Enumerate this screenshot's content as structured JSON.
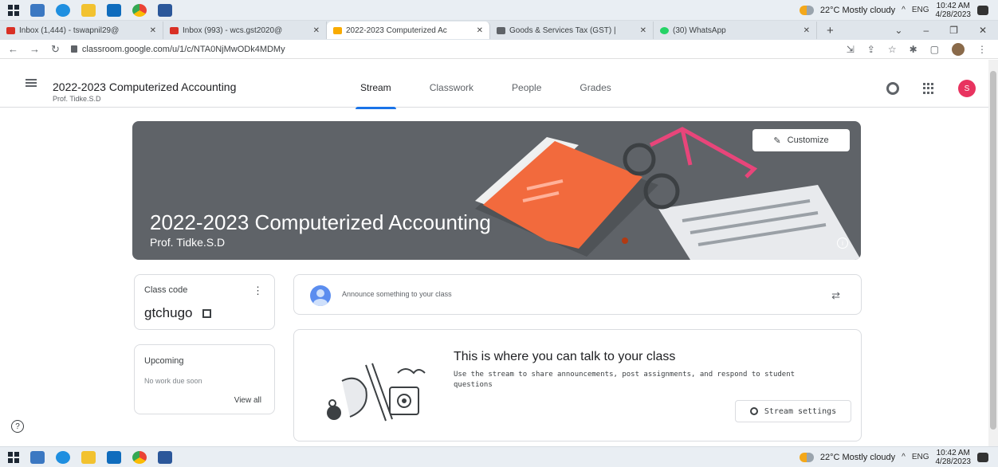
{
  "taskbar": {
    "weather": "22°C  Mostly cloudy",
    "lang": "ENG",
    "time": "10:42 AM",
    "date": "4/28/2023"
  },
  "browser_tabs": [
    {
      "title": "Inbox (1,444) - tswapnil29@",
      "color": "#d93025"
    },
    {
      "title": "Inbox (993) - wcs.gst2020@",
      "color": "#d93025"
    },
    {
      "title": "2022-2023 Computerized Ac",
      "color": "#f9ab00",
      "active": true
    },
    {
      "title": "Goods & Services Tax (GST) |",
      "color": "#3c4043"
    },
    {
      "title": "(30) WhatsApp",
      "color": "#25d366"
    }
  ],
  "address": {
    "url": "classroom.google.com/u/1/c/NTA0NjMwODk4MDMy"
  },
  "classroom": {
    "class_title": "2022-2023 Computerized Accounting",
    "teacher": "Prof. Tidke.S.D",
    "tabs": [
      "Stream",
      "Classwork",
      "People",
      "Grades"
    ],
    "avatar_letter": "S",
    "customize_label": "Customize",
    "banner_title": "2022-2023 Computerized Accounting",
    "banner_subtitle": "Prof. Tidke.S.D",
    "class_code_label": "Class code",
    "class_code": "gtchugo",
    "upcoming_label": "Upcoming",
    "upcoming_empty": "No work due soon",
    "view_all": "View all",
    "announce_placeholder": "Announce something to your class",
    "talk_heading": "This is where you can talk to your class",
    "talk_body": "Use the stream to share announcements, post assignments, and respond to student questions",
    "stream_settings": "Stream settings"
  },
  "colors": {
    "banner": "#5f6368",
    "accent": "#1a73e8",
    "book": "#f26a3d",
    "glasses": "#e8457a",
    "avatar": "#e8335f"
  }
}
